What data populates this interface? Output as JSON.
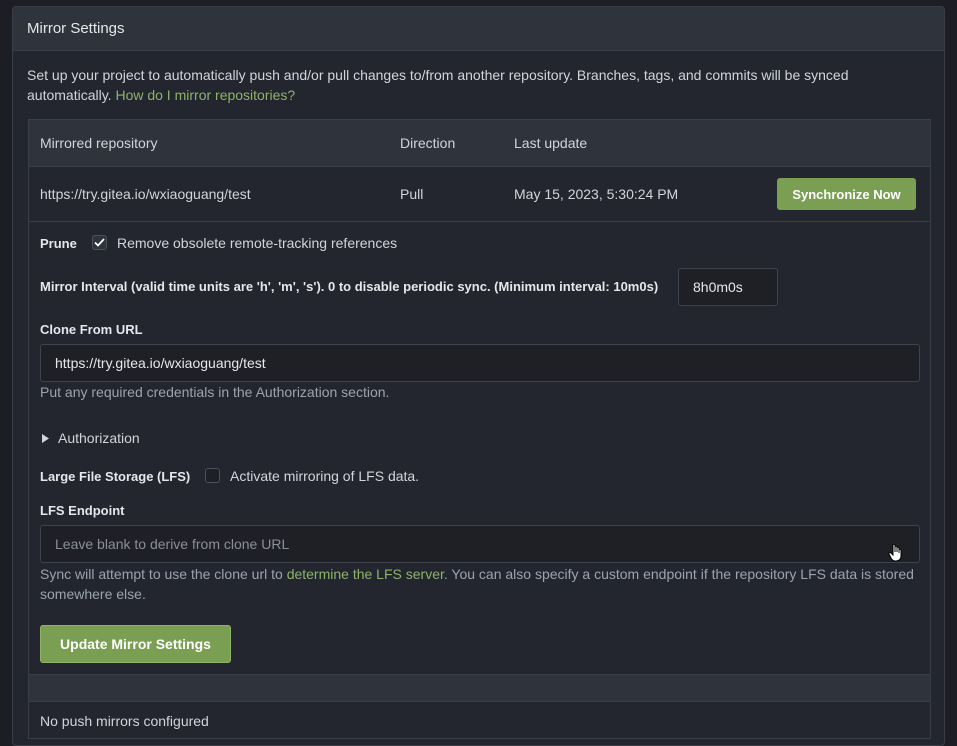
{
  "panel": {
    "title": "Mirror Settings",
    "intro_text": "Set up your project to automatically push and/or pull changes to/from another repository. Branches, tags, and commits will be synced automatically.",
    "intro_link": "How do I mirror repositories?"
  },
  "table": {
    "headers": [
      "Mirrored repository",
      "Direction",
      "Last update"
    ],
    "row": {
      "repository": "https://try.gitea.io/wxiaoguang/test",
      "direction": "Pull",
      "last_update": "May 15, 2023, 5:30:24 PM",
      "sync_button": "Synchronize Now"
    }
  },
  "form": {
    "prune_label": "Prune",
    "prune_checkbox_label": "Remove obsolete remote-tracking references",
    "prune_checked": true,
    "interval_label": "Mirror Interval (valid time units are 'h', 'm', 's'). 0 to disable periodic sync. (Minimum interval: 10m0s)",
    "interval_value": "8h0m0s",
    "clone_label": "Clone From URL",
    "clone_value": "https://try.gitea.io/wxiaoguang/test",
    "clone_help": "Put any required credentials in the Authorization section.",
    "authorization_toggle": "Authorization",
    "lfs_label": "Large File Storage (LFS)",
    "lfs_checkbox_label": "Activate mirroring of LFS data.",
    "lfs_checked": false,
    "lfs_endpoint_label": "LFS Endpoint",
    "lfs_endpoint_placeholder": "Leave blank to derive from clone URL",
    "lfs_help_before": "Sync will attempt to use the clone url to",
    "lfs_help_link": "determine the LFS server",
    "lfs_help_after": ". You can also specify a custom endpoint if the repository LFS data is stored somewhere else.",
    "update_button": "Update Mirror Settings"
  },
  "push_mirrors": {
    "empty_text": "No push mirrors configured"
  },
  "colors": {
    "accent": "#7a9e52",
    "link": "#8fb26b",
    "background": "#1c1e24"
  }
}
